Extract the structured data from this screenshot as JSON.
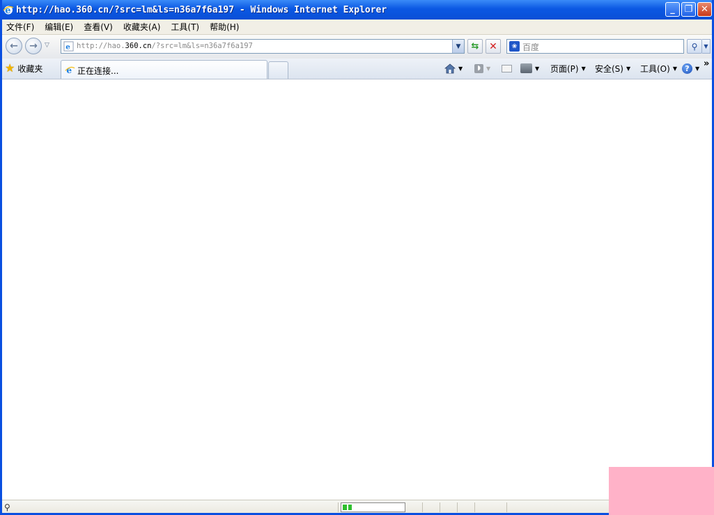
{
  "window": {
    "title": "http://hao.360.cn/?src=lm&ls=n36a7f6a197 - Windows Internet Explorer"
  },
  "menu": [
    "文件(F)",
    "编辑(E)",
    "查看(V)",
    "收藏夹(A)",
    "工具(T)",
    "帮助(H)"
  ],
  "address": {
    "url_dim_prefix": "http://hao.",
    "url_host": "360.cn",
    "url_dim_suffix": "/?src=lm&ls=n36a7f6a197"
  },
  "search": {
    "placeholder": "百度"
  },
  "favorites": {
    "label": "收藏夹"
  },
  "tab": {
    "label": "正在连接..."
  },
  "commands": {
    "page": "页面(P)",
    "safety": "安全(S)",
    "tools": "工具(O)"
  },
  "status": {
    "progress": 0.15
  },
  "colors": {
    "titlebar": "#0b58e3",
    "frame": "#0a4fe0",
    "progress": "#2fbf2f",
    "overlay": "#ffb2c8"
  }
}
